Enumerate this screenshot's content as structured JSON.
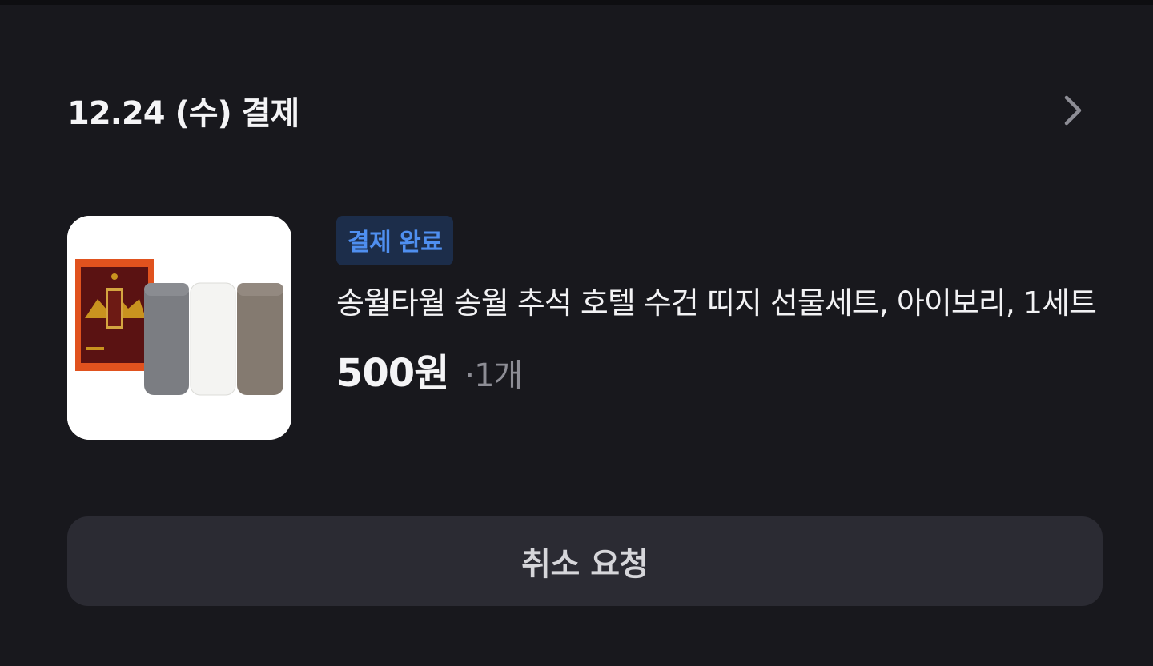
{
  "order": {
    "date_title": "12.24 (수) 결제",
    "chevron_icon": "chevron-right-icon",
    "status_badge": "결제 완료",
    "product_name": "송월타월 송월 추석 호텔 수건 띠지 선물세트, 아이보리, 1세트",
    "price": "500원",
    "quantity": "·1개",
    "cancel_label": "취소 요청",
    "product_image_icon": "towel-gift-set-image"
  },
  "colors": {
    "background": "#18181d",
    "badge_bg": "#1c2d4a",
    "badge_text": "#4f8ff0",
    "button_bg": "#2b2b33",
    "muted_text": "#8d8d95"
  }
}
